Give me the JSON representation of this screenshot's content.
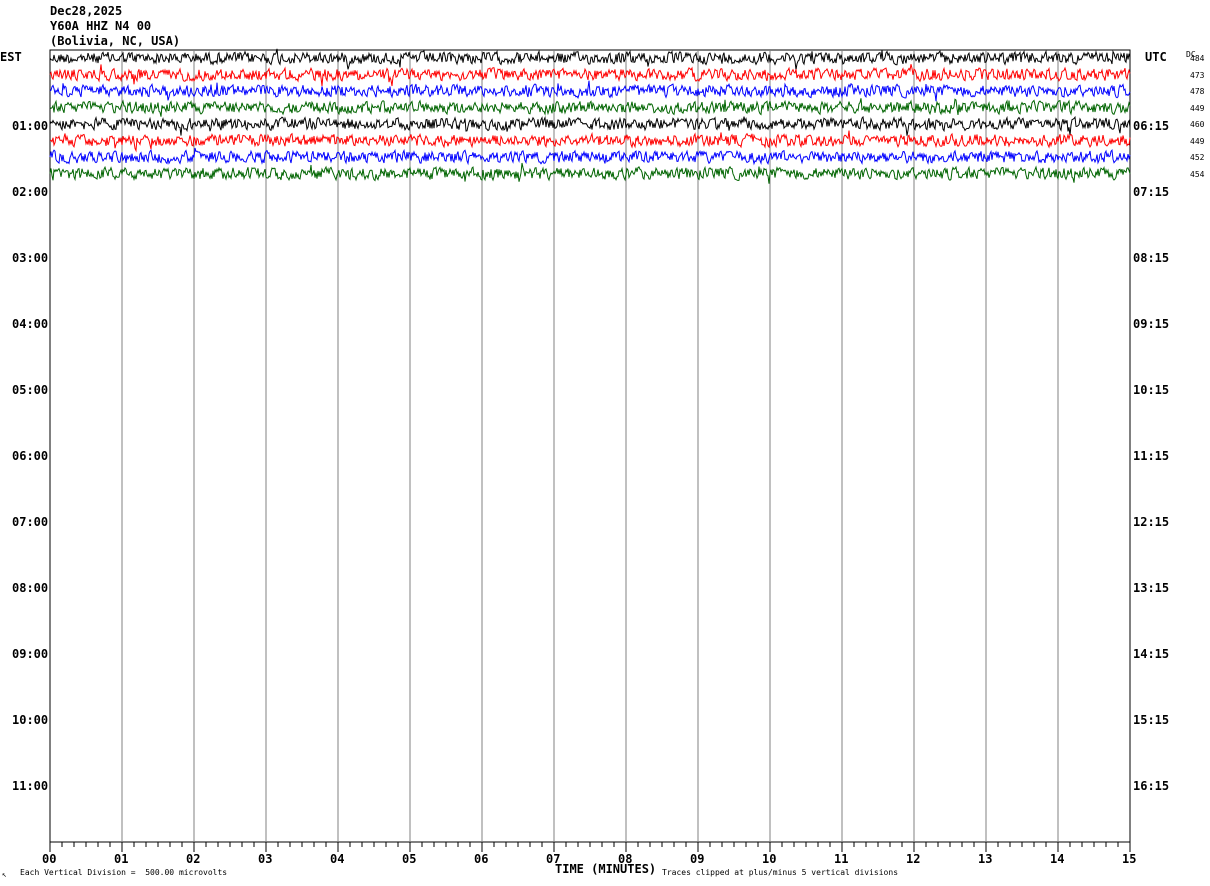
{
  "header": {
    "date": "Dec28,2025",
    "station": "Y60A HHZ N4 00",
    "location": "(Bolivia, NC, USA)"
  },
  "left_axis": {
    "label": "EST"
  },
  "right_axis": {
    "label": "UTC",
    "dc_label": "DC"
  },
  "footer": {
    "corner_mark": "↖",
    "scale_note": "Each Vertical Division =  500.00 microvolts",
    "clip_note": "Traces clipped at plus/minus 5 vertical divisions"
  },
  "chart_data": {
    "type": "line",
    "title": "",
    "xlabel": "TIME (MINUTES)",
    "xlim": [
      0,
      15
    ],
    "x_ticks": [
      "00",
      "01",
      "02",
      "03",
      "04",
      "05",
      "06",
      "07",
      "08",
      "09",
      "10",
      "11",
      "12",
      "13",
      "14",
      "15"
    ],
    "left_hour_labels": [
      "01:00",
      "02:00",
      "03:00",
      "04:00",
      "05:00",
      "06:00",
      "07:00",
      "08:00",
      "09:00",
      "10:00",
      "11:00"
    ],
    "right_hour_labels": [
      "06:15",
      "07:15",
      "08:15",
      "09:15",
      "10:15",
      "11:15",
      "12:15",
      "13:15",
      "14:15",
      "15:15",
      "16:15"
    ],
    "trace_colors": [
      "#000000",
      "#ff0000",
      "#0000ff",
      "#006400"
    ],
    "traces": [
      {
        "dc": "484",
        "color": "#000000"
      },
      {
        "dc": "473",
        "color": "#ff0000"
      },
      {
        "dc": "478",
        "color": "#0000ff"
      },
      {
        "dc": "449",
        "color": "#006400"
      },
      {
        "dc": "460",
        "color": "#000000"
      },
      {
        "dc": "449",
        "color": "#ff0000"
      },
      {
        "dc": "452",
        "color": "#0000ff"
      },
      {
        "dc": "454",
        "color": "#006400"
      }
    ],
    "grid": true
  }
}
